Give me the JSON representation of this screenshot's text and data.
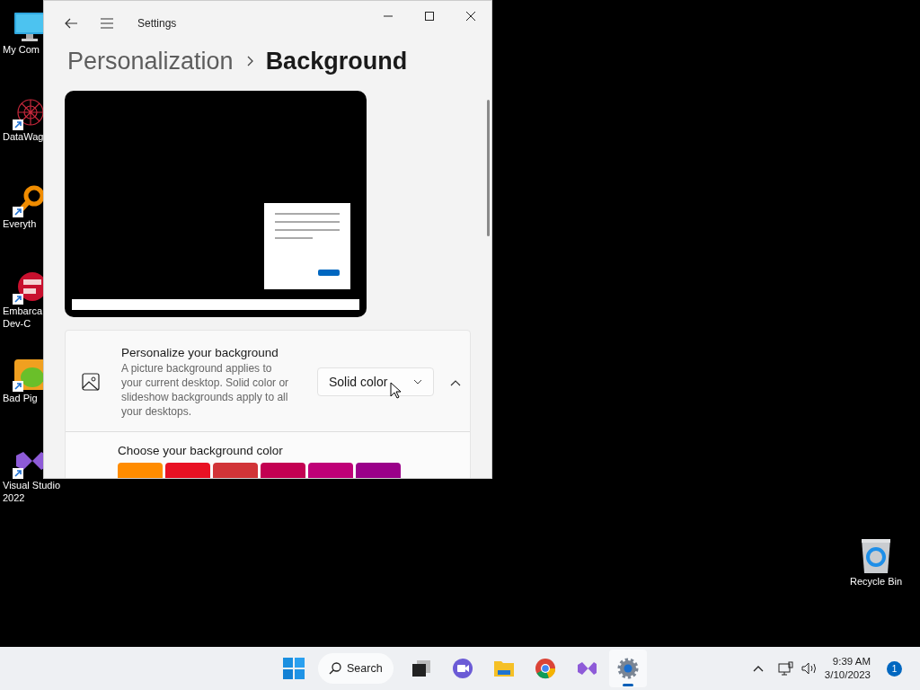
{
  "desktop_icons": [
    {
      "kind": "computer",
      "lines": [
        "My Com"
      ],
      "shortcut": false
    },
    {
      "kind": "web",
      "lines": [
        "DataWag"
      ],
      "shortcut": true
    },
    {
      "kind": "magnifier",
      "lines": [
        "Everyth"
      ],
      "shortcut": true
    },
    {
      "kind": "devcpp",
      "lines": [
        "Embarca",
        "Dev-C"
      ],
      "shortcut": true
    },
    {
      "kind": "pig",
      "lines": [
        "Bad Pig"
      ],
      "shortcut": true
    },
    {
      "kind": "vs",
      "lines": [
        "Visual Studio",
        "2022"
      ],
      "shortcut": true
    }
  ],
  "recycle_bin": {
    "label": "Recycle Bin"
  },
  "window": {
    "title": "Settings",
    "breadcrumb": [
      "Personalization",
      "Background"
    ],
    "personalize": {
      "title": "Personalize your background",
      "description": "A picture background applies to your current desktop. Solid color or slideshow backgrounds apply to all your desktops.",
      "dropdown": "Solid color",
      "expanded": true
    },
    "color_section": {
      "title": "Choose your background color",
      "swatches": [
        {
          "color": "#ff8c00",
          "selected": false
        },
        {
          "color": "#e81123",
          "selected": false
        },
        {
          "color": "#d13438",
          "selected": false
        },
        {
          "color": "#c30052",
          "selected": false
        },
        {
          "color": "#bf0077",
          "selected": false
        },
        {
          "color": "#9a0089",
          "selected": false
        }
      ]
    }
  },
  "taskbar": {
    "search": {
      "label": "Search"
    },
    "apps": [
      {
        "kind": "taskview",
        "active": false
      },
      {
        "kind": "chat",
        "active": false
      },
      {
        "kind": "folder",
        "active": false
      },
      {
        "kind": "browser",
        "active": false
      },
      {
        "kind": "vs",
        "active": false
      },
      {
        "kind": "gear",
        "active": true
      }
    ],
    "clock": {
      "time": "9:39 AM",
      "date": "3/10/2023"
    },
    "notifications": "1"
  }
}
